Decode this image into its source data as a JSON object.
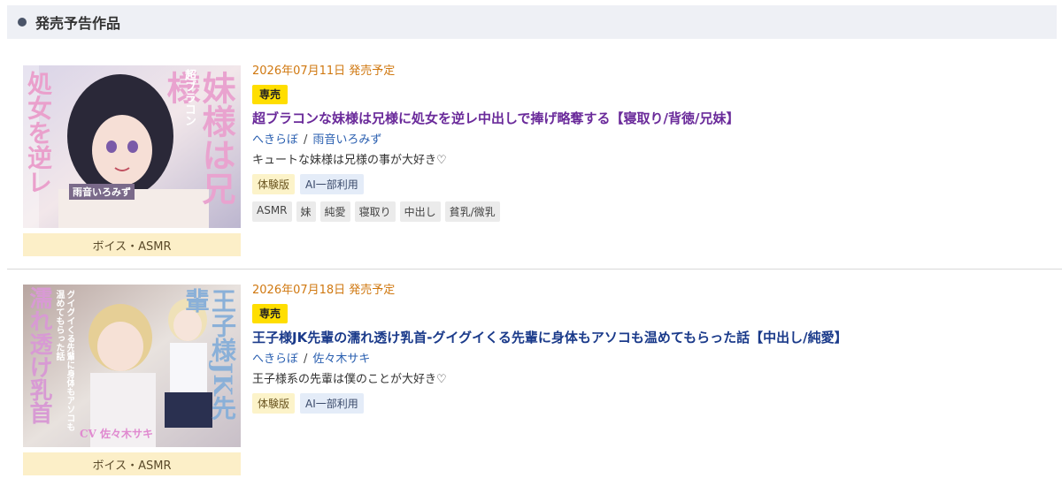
{
  "section": {
    "title": "発売予告作品"
  },
  "products": [
    {
      "release": "2026年07月11日 発売予定",
      "badge": "専売",
      "title": "超ブラコンな妹様は兄様に処女を逆レ中出しで捧げ略奪する【寝取り/背徳/兄妹】",
      "circle": "へきらぼ",
      "separator": "/",
      "cv": "雨音いろみず",
      "description": "キュートな妹様は兄様の事が大好き♡",
      "tags": [
        "体験版",
        "AI一部利用"
      ],
      "genres": [
        "ASMR",
        "妹",
        "純愛",
        "寝取り",
        "中出し",
        "貧乳/微乳"
      ],
      "category": "ボイス・ASMR",
      "thumb_text": {
        "vertical_main": "妹様は兄様",
        "vertical_sub": "超ブラコン",
        "left": "処女を逆レ",
        "cv": "雨音いろみず"
      }
    },
    {
      "release": "2026年07月18日 発売予定",
      "badge": "専売",
      "title": "王子様JK先輩の濡れ透け乳首-グイグイくる先輩に身体もアソコも温めてもらった話【中出し/純愛】",
      "circle": "へきらぼ",
      "separator": "/",
      "cv": "佐々木サキ",
      "description": "王子様系の先輩は僕のことが大好き♡",
      "tags": [
        "体験版",
        "AI一部利用"
      ],
      "genres": [],
      "category": "ボイス・ASMR",
      "thumb_text": {
        "vertical_main": "王子様JK先輩",
        "left_big": "濡れ透け乳首",
        "sub": "グイグイくる先輩に身体もアソコも温めてもらった話",
        "cv": "CV 佐々木サキ"
      }
    }
  ],
  "colors": {
    "release": "#d07810",
    "badge": "#ffde00",
    "title1": "#6a2a9a",
    "title2": "#1a3a8a",
    "link": "#2a5fb0",
    "category_bg": "#fcefc8"
  }
}
